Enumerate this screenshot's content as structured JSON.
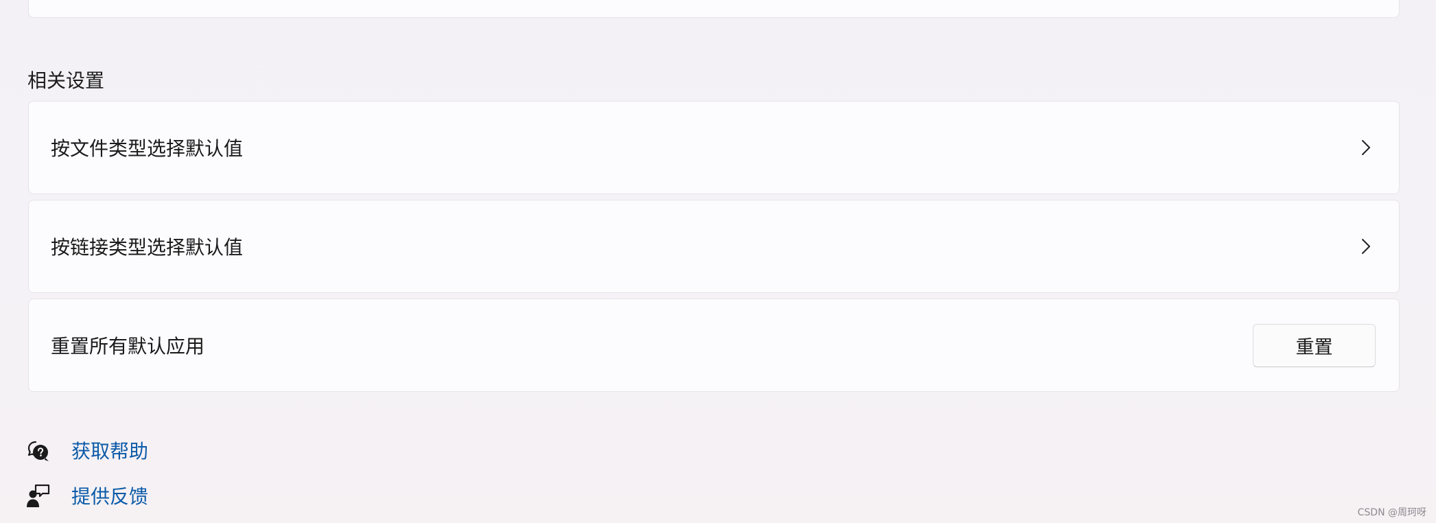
{
  "related_settings": {
    "title": "相关设置",
    "items": [
      {
        "label": "按文件类型选择默认值",
        "icon": "chevron-right-icon"
      },
      {
        "label": "按链接类型选择默认值",
        "icon": "chevron-right-icon"
      },
      {
        "label": "重置所有默认应用",
        "button_label": "重置"
      }
    ]
  },
  "links": [
    {
      "label": "获取帮助",
      "icon": "help-chat-icon"
    },
    {
      "label": "提供反馈",
      "icon": "feedback-icon"
    }
  ],
  "watermark": "CSDN @周珂呀",
  "colors": {
    "link": "#0a5aa8",
    "card_bg": "#fcfbfd",
    "card_border": "#e6e3e8"
  }
}
